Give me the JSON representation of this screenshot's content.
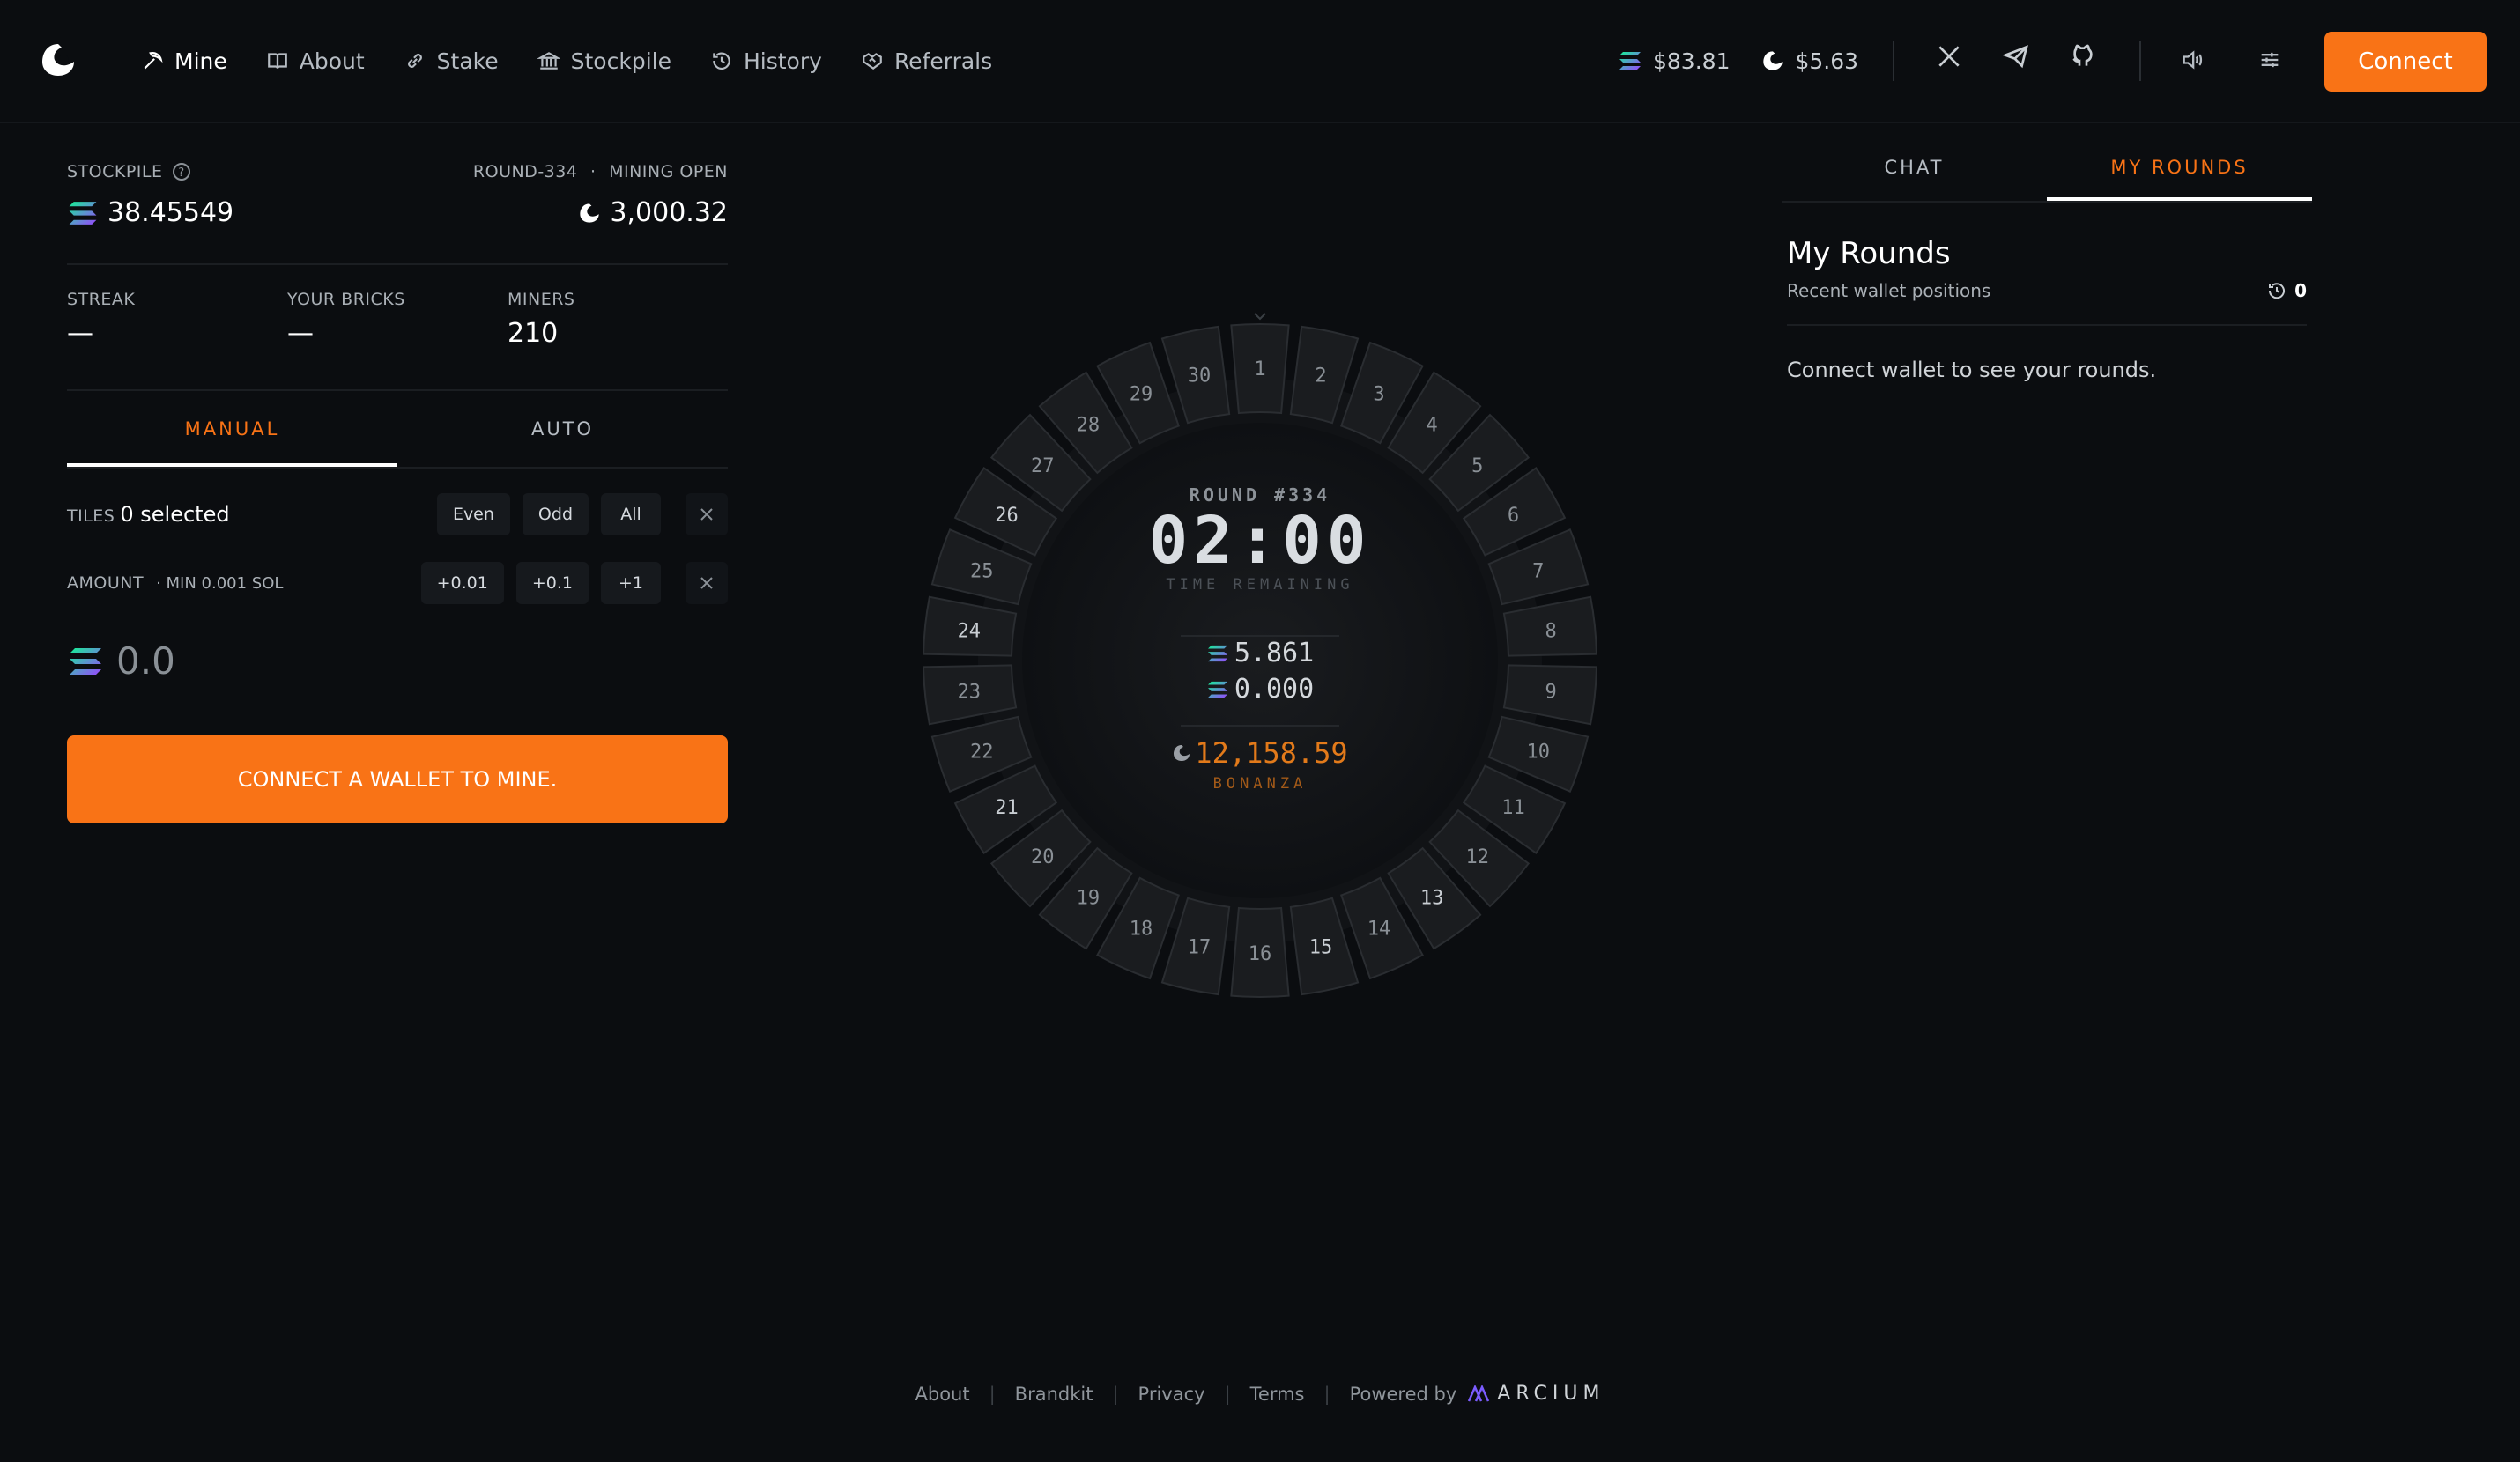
{
  "nav": {
    "items": [
      {
        "label": "Mine",
        "icon": "pickaxe-icon",
        "active": true
      },
      {
        "label": "About",
        "icon": "book-icon",
        "active": false
      },
      {
        "label": "Stake",
        "icon": "link-icon",
        "active": false
      },
      {
        "label": "Stockpile",
        "icon": "vault-icon",
        "active": false
      },
      {
        "label": "History",
        "icon": "history-icon",
        "active": false
      },
      {
        "label": "Referrals",
        "icon": "handshake-icon",
        "active": false
      }
    ]
  },
  "prices": {
    "sol": "$83.81",
    "token": "$5.63"
  },
  "header": {
    "connect_label": "Connect"
  },
  "stockpile": {
    "label": "STOCKPILE",
    "sol_value": "38.45549",
    "round_label": "ROUND-334",
    "status": "MINING OPEN",
    "token_value": "3,000.32"
  },
  "stats": {
    "streak_label": "STREAK",
    "streak_value": "—",
    "bricks_label": "YOUR BRICKS",
    "bricks_value": "—",
    "miners_label": "MINERS",
    "miners_value": "210"
  },
  "mode_tabs": {
    "manual": "MANUAL",
    "auto": "AUTO"
  },
  "tiles": {
    "label": "TILES",
    "selected": "0 selected",
    "even": "Even",
    "odd": "Odd",
    "all": "All"
  },
  "amount": {
    "label": "AMOUNT",
    "min": "· MIN 0.001 SOL",
    "p001": "+0.01",
    "p01": "+0.1",
    "p1": "+1",
    "value": "0.0"
  },
  "cta": {
    "label": "CONNECT A WALLET TO MINE."
  },
  "wheel": {
    "round": "ROUND #334",
    "timer": "02:00",
    "time_remaining": "TIME REMAINING",
    "sol_total": "5.861",
    "sol_yours": "0.000",
    "bonanza_value": "12,158.59",
    "bonanza_label": "BONANZA",
    "tiles": [
      "1",
      "2",
      "3",
      "4",
      "5",
      "6",
      "7",
      "8",
      "9",
      "10",
      "11",
      "12",
      "13",
      "14",
      "15",
      "16",
      "17",
      "18",
      "19",
      "20",
      "21",
      "22",
      "23",
      "24",
      "25",
      "26",
      "27",
      "28",
      "29",
      "30"
    ]
  },
  "right": {
    "tab_chat": "CHAT",
    "tab_rounds": "MY ROUNDS",
    "title": "My Rounds",
    "subtitle": "Recent wallet positions",
    "count": "0",
    "empty": "Connect wallet to see your rounds."
  },
  "footer": {
    "links": [
      "About",
      "Brandkit",
      "Privacy",
      "Terms"
    ],
    "powered": "Powered by",
    "brand": "ARCIUM"
  },
  "colors": {
    "accent": "#f97316",
    "bg": "#0b0d10"
  }
}
